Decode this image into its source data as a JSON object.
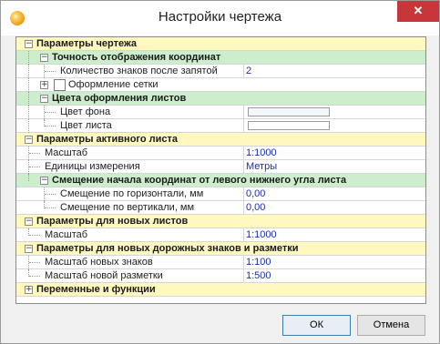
{
  "window": {
    "title": "Настройки чертежа",
    "close_glyph": "✕"
  },
  "icons": {
    "app": "app-logo-icon",
    "expanded": "collapse-icon",
    "collapsed": "expand-icon"
  },
  "grid": {
    "drawing_params": "Параметры чертежа",
    "coord_precision": "Точность отображения координат",
    "decimal_digits_label": "Количество знаков после запятой",
    "decimal_digits_value": "2",
    "grid_style": "Оформление сетки",
    "sheet_colors": "Цвета оформления листов",
    "bg_color_label": "Цвет фона",
    "sheet_color_label": "Цвет листа",
    "active_sheet_params": "Параметры активного листа",
    "scale_label": "Масштаб",
    "scale_value": "1:1000",
    "units_label": "Единицы измерения",
    "units_value": "Метры",
    "origin_offset": "Смещение начала координат от левого нижнего угла листа",
    "offset_h_label": "Смещение по горизонтали, мм",
    "offset_h_value": "0,00",
    "offset_v_label": "Смещение по вертикали, мм",
    "offset_v_value": "0,00",
    "new_sheets_params": "Параметры для новых листов",
    "new_scale_label": "Масштаб",
    "new_scale_value": "1:1000",
    "road_params": "Параметры для новых дорожных знаков и разметки",
    "signs_scale_label": "Масштаб новых знаков",
    "signs_scale_value": "1:100",
    "marking_scale_label": "Масштаб новой разметки",
    "marking_scale_value": "1:500",
    "variables": "Переменные и функции"
  },
  "buttons": {
    "ok": "ОК",
    "cancel": "Отмена"
  },
  "colors": {
    "category_bg": "#fff9c0",
    "subcategory_bg": "#cdeecd",
    "value_text": "#1c2fa8",
    "close_bg": "#c7373a"
  }
}
